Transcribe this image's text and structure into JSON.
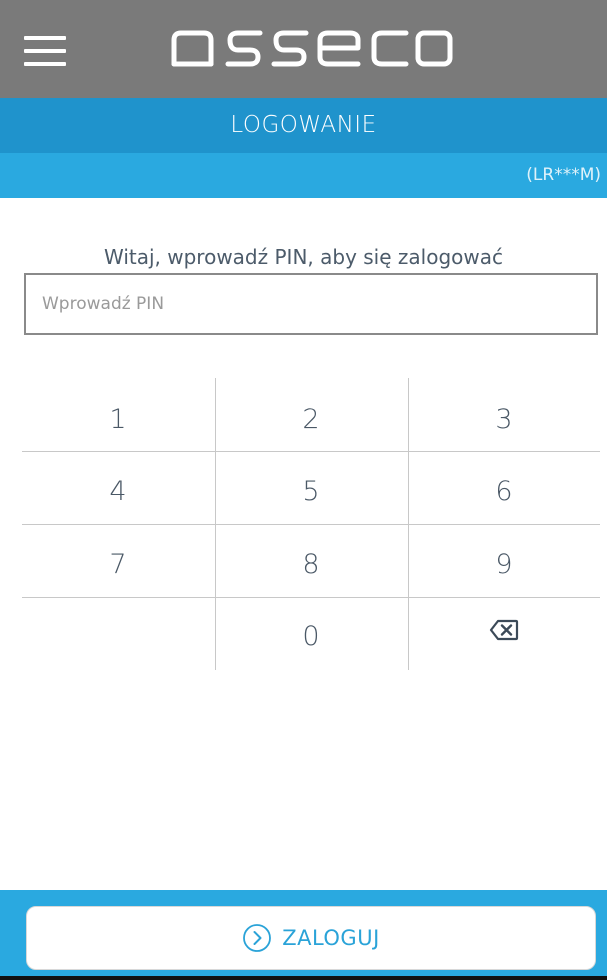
{
  "header": {
    "menu_icon": "hamburger-menu-icon",
    "logo_text": "asseco",
    "background": "#7a7a7a"
  },
  "title_bar": {
    "title": "LOGOWANIE",
    "color": "#1f93cc"
  },
  "user_bar": {
    "user_code": "(LR***M)",
    "color": "#2aa9e0"
  },
  "login": {
    "greeting": "Witaj, wprowadź PIN, aby się zalogować",
    "pin_placeholder": "Wprowadź PIN",
    "pin_value": ""
  },
  "keypad": {
    "keys": [
      "1",
      "2",
      "3",
      "4",
      "5",
      "6",
      "7",
      "8",
      "9",
      "",
      "0",
      "⌫"
    ],
    "backspace_icon": "backspace-icon"
  },
  "footer": {
    "login_button_label": "ZALOGUJ",
    "login_button_icon": "chevron-right-circle-icon",
    "accent": "#2aa3d8"
  }
}
